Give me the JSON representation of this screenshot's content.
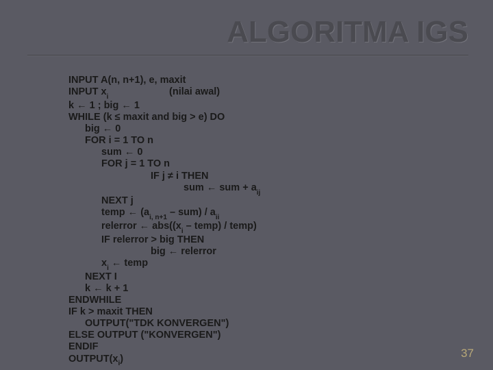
{
  "title": "ALGORITMA IGS",
  "pagenum": "37",
  "code": {
    "l1a": "INPUT A(n, n+1), e, maxit",
    "l2a": "INPUT x",
    "l2b": "i",
    "l2c": "                      (nilai awal)",
    "l3": "k ← 1 ; big ← 1",
    "l4": "WHILE (k ≤ maxit and big > e) DO",
    "l5": "big ← 0",
    "l6": "FOR i = 1 TO n",
    "l7": "sum ← 0",
    "l8": "FOR j = 1 TO n",
    "l9": "IF j ≠ i THEN",
    "l10a": "sum ← sum + a",
    "l10b": "ij",
    "l11": "NEXT j",
    "l12a": "temp ← (a",
    "l12b": "i, n+1",
    "l12c": " – sum) / a",
    "l12d": "ii",
    "l13a": "relerror ← abs((x",
    "l13b": "i",
    "l13c": " – temp) / temp)",
    "l14": "IF relerror > big THEN",
    "l15": "big ← relerror",
    "l16a": "x",
    "l16b": "i",
    "l16c": " ← temp",
    "l17": "NEXT I",
    "l18": "k ← k + 1",
    "l19": "ENDWHILE",
    "l20": "IF k > maxit THEN",
    "l21": "OUTPUT(\"TDK KONVERGEN\")",
    "l22": "ELSE OUTPUT (\"KONVERGEN\")",
    "l23": "ENDIF",
    "l24a": "OUTPUT(x",
    "l24b": "i",
    "l24c": ")"
  }
}
